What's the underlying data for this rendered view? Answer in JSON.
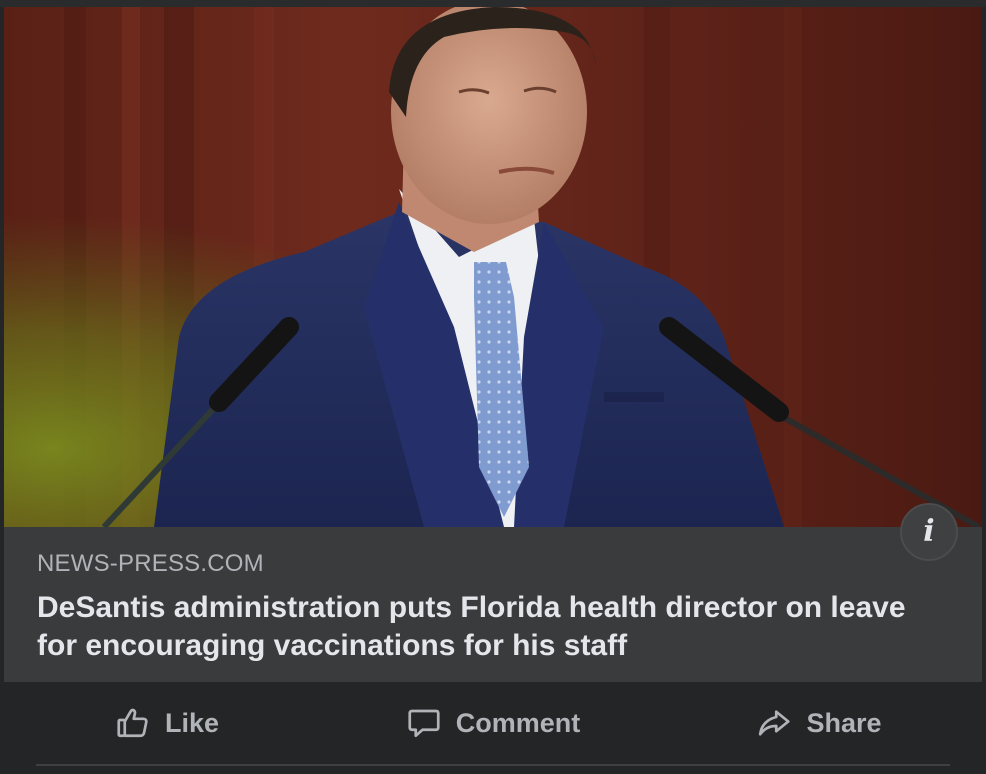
{
  "link_preview": {
    "domain": "NEWS-PRESS.COM",
    "headline": "DeSantis administration puts Florida health director on leave for encouraging vaccinations for his staff",
    "image_alt": "Man in navy suit and blue tie standing at a podium with two microphones"
  },
  "actions": {
    "like_label": "Like",
    "comment_label": "Comment",
    "share_label": "Share"
  },
  "icons": {
    "info": "info-icon",
    "like": "thumbs-up-icon",
    "comment": "speech-bubble-icon",
    "share": "share-arrow-icon"
  },
  "colors": {
    "card_background": "#3a3b3c",
    "page_background": "#242526",
    "primary_text": "#e4e6eb",
    "secondary_text": "#b0b3b8"
  }
}
